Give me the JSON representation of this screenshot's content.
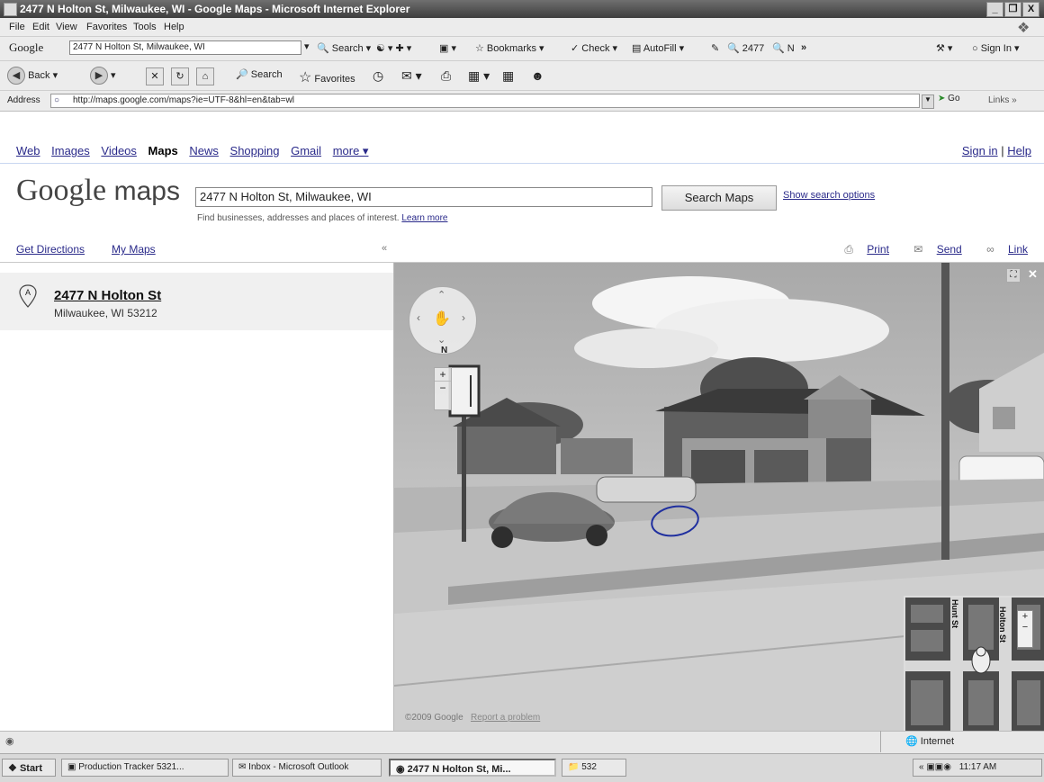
{
  "window": {
    "title": "2477 N Holton St, Milwaukee, WI - Google Maps - Microsoft Internet Explorer",
    "minimize": "_",
    "maximize": "❐",
    "close": "X"
  },
  "menu": [
    "File",
    "Edit",
    "View",
    "Favorites",
    "Tools",
    "Help"
  ],
  "google_toolbar": {
    "brand": "Google",
    "search_value": "2477 N Holton St, Milwaukee, WI",
    "search_label": "Search",
    "bookmarks_label": "Bookmarks",
    "check_label": "Check",
    "autofill_label": "AutoFill",
    "highlight_1": "2477",
    "highlight_2": "N",
    "more": "»",
    "signin_label": "Sign In"
  },
  "nav_toolbar": {
    "back_label": "Back",
    "search_label": "Search",
    "favorites_label": "Favorites"
  },
  "address_bar": {
    "label": "Address",
    "url": "http://maps.google.com/maps?ie=UTF-8&hl=en&tab=wl",
    "go_label": "Go",
    "links_label": "Links »"
  },
  "google_links": {
    "items": [
      "Web",
      "Images",
      "Videos",
      "Maps",
      "News",
      "Shopping",
      "Gmail",
      "more ▾"
    ],
    "active": "Maps",
    "sign_in": "Sign in",
    "separator": "|",
    "help": "Help"
  },
  "maps_header": {
    "logo_google": "Google",
    "logo_maps": "maps",
    "search_value": "2477 N Holton St, Milwaukee, WI",
    "search_button": "Search Maps",
    "show_options": "Show search options",
    "hint": "Find businesses, addresses and places of interest.",
    "learn_more": "Learn more"
  },
  "left_panel": {
    "get_directions": "Get Directions",
    "my_maps": "My Maps",
    "collapse": "«",
    "result": {
      "marker": "A",
      "name": "2477 N Holton St",
      "city": "Milwaukee, WI 53212"
    }
  },
  "map_actions": {
    "print": "Print",
    "send": "Send",
    "link": "Link"
  },
  "street_view": {
    "compass_label": "N",
    "zoom_in": "+",
    "zoom_out": "−",
    "copyright": "©2009 Google",
    "report": "Report a problem",
    "minimap_labels": [
      "Holton St",
      "Hunt St"
    ]
  },
  "status_bar": {
    "zone": "Internet"
  },
  "taskbar": {
    "start": "Start",
    "tasks": [
      "Production Tracker 5321...",
      "Inbox - Microsoft Outlook",
      "2477 N Holton St, Mi...",
      "532"
    ],
    "clock": "11:17 AM"
  }
}
